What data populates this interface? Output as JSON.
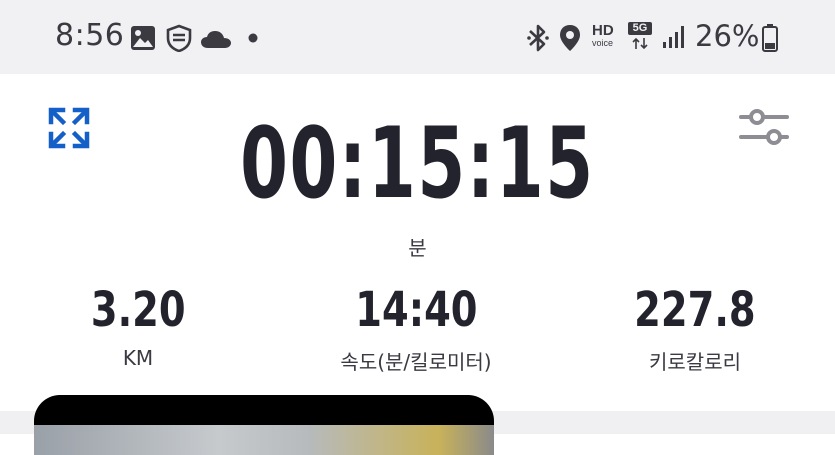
{
  "status_bar": {
    "time": "8:56",
    "battery_percent": "26%",
    "hd_label": "HD",
    "voice_label": "voice",
    "network_label": "5G",
    "icons_left": [
      "gallery-icon",
      "app-shield-icon",
      "cloud-icon",
      "dot-icon"
    ],
    "icons_right": [
      "bluetooth-icon",
      "location-icon",
      "hd-voice-icon",
      "5g-icon",
      "signal-icon",
      "battery-icon"
    ]
  },
  "workout": {
    "timer": "00:15:15",
    "timer_unit": "분",
    "stats": [
      {
        "value": "3.20",
        "label": "KM"
      },
      {
        "value": "14:40",
        "label": "속도(분/킬로미터)"
      },
      {
        "value": "227.8",
        "label": "키로칼로리"
      }
    ]
  },
  "colors": {
    "accent": "#1560c8",
    "text_dark": "#23232d",
    "status_bg": "#f1f1f4"
  }
}
